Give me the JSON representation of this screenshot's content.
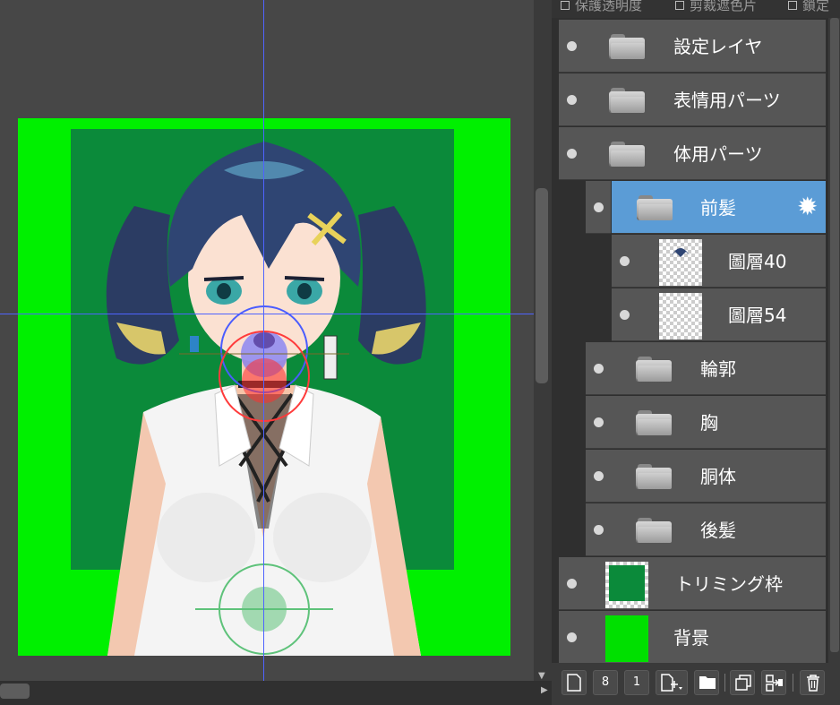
{
  "layer_options": {
    "protect_opacity": "保護透明度",
    "clipping_mask": "剪裁遮色片",
    "lock": "鎖定"
  },
  "layers": [
    {
      "name": "設定レイヤ",
      "type": "folder"
    },
    {
      "name": "表情用パーツ",
      "type": "folder"
    },
    {
      "name": "体用パーツ",
      "type": "folder"
    },
    {
      "name": "前髪",
      "type": "folder",
      "selected": true
    },
    {
      "name": "圖層40",
      "type": "image"
    },
    {
      "name": "圖層54",
      "type": "image"
    },
    {
      "name": "輪郭",
      "type": "folder"
    },
    {
      "name": "胸",
      "type": "folder"
    },
    {
      "name": "胴体",
      "type": "folder"
    },
    {
      "name": "後髪",
      "type": "folder"
    },
    {
      "name": "トリミング枠",
      "type": "image"
    },
    {
      "name": "背景",
      "type": "image"
    }
  ],
  "toolbar": {
    "page8_label": "8",
    "page1_label": "1"
  },
  "colors": {
    "selected_layer": "#5b9cd6",
    "canvas_green": "#00f000",
    "trim_frame": "#0b8a3a",
    "guide": "#4f63ff"
  }
}
